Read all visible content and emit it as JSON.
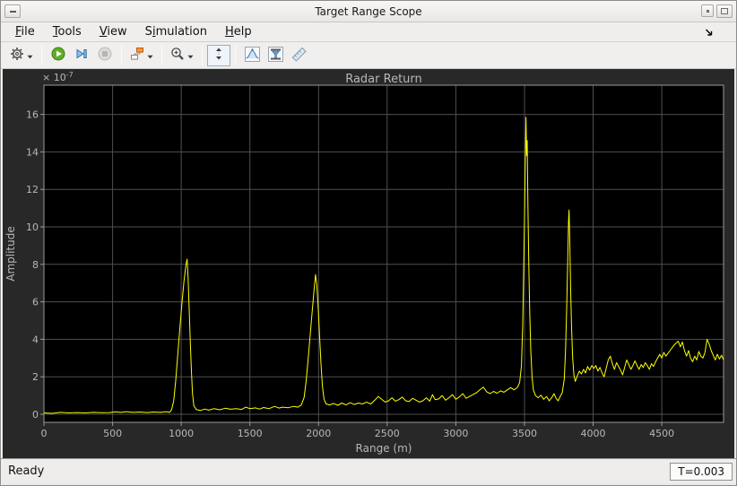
{
  "window": {
    "title": "Target Range Scope"
  },
  "titlebar": {
    "left_button": {
      "name": "minimize-button",
      "glyph": "dash"
    },
    "right_buttons": [
      {
        "name": "restore-button",
        "glyph": "dot"
      },
      {
        "name": "maximize-button",
        "glyph": "square"
      }
    ]
  },
  "menu": {
    "items": [
      {
        "label": "File",
        "mnemonic_index": 0
      },
      {
        "label": "Tools",
        "mnemonic_index": 0
      },
      {
        "label": "View",
        "mnemonic_index": 0
      },
      {
        "label": "Simulation",
        "mnemonic_index": 1
      },
      {
        "label": "Help",
        "mnemonic_index": 0
      }
    ],
    "dock_icon": "dock-arrow-icon"
  },
  "toolbar": {
    "items": [
      {
        "type": "button",
        "name": "settings",
        "icon": "gear-icon",
        "caret": true
      },
      {
        "type": "separator"
      },
      {
        "type": "button",
        "name": "run",
        "icon": "play-icon"
      },
      {
        "type": "button",
        "name": "step-forward",
        "icon": "step-forward-icon"
      },
      {
        "type": "button",
        "name": "stop",
        "icon": "stop-icon",
        "disabled": true
      },
      {
        "type": "separator"
      },
      {
        "type": "button",
        "name": "highlight-simulink-block",
        "icon": "simulink-block-icon",
        "caret": true
      },
      {
        "type": "separator"
      },
      {
        "type": "button",
        "name": "zoom",
        "icon": "zoom-in-icon",
        "caret": true
      },
      {
        "type": "separator"
      },
      {
        "type": "button",
        "name": "scale-y-axis",
        "icon": "fit-vertical-icon",
        "bordered": true
      },
      {
        "type": "separator"
      },
      {
        "type": "button",
        "name": "peak-finder",
        "icon": "peak-finder-icon"
      },
      {
        "type": "button",
        "name": "cursor-measurements",
        "icon": "cursor-measurements-icon"
      },
      {
        "type": "button",
        "name": "signal-statistics",
        "icon": "ruler-icon"
      }
    ]
  },
  "chart_data": {
    "type": "line",
    "title": "Radar Return",
    "xlabel": "Range (m)",
    "ylabel": "Amplitude",
    "y_multiplier_text": "× 10",
    "y_exponent": "-7",
    "xlim": [
      0,
      4950
    ],
    "ylim": [
      -0.43,
      17.56
    ],
    "xticks": [
      0,
      500,
      1000,
      1500,
      2000,
      2500,
      3000,
      3500,
      4000,
      4500
    ],
    "yticks": [
      0,
      2,
      4,
      6,
      8,
      10,
      12,
      14,
      16
    ],
    "grid": true,
    "legend": null,
    "colors": {
      "line": "#ffff00",
      "plot_bg": "#000000",
      "scope_bg": "#282828",
      "grid": "#4f4f4f",
      "axis": "#9a9a9a",
      "text": "#b8b8b8"
    },
    "series": [
      {
        "name": "radar-return",
        "points": [
          [
            0,
            0.07
          ],
          [
            60,
            0.05
          ],
          [
            120,
            0.1
          ],
          [
            180,
            0.07
          ],
          [
            240,
            0.09
          ],
          [
            300,
            0.07
          ],
          [
            360,
            0.1
          ],
          [
            420,
            0.08
          ],
          [
            480,
            0.09
          ],
          [
            520,
            0.13
          ],
          [
            560,
            0.1
          ],
          [
            600,
            0.14
          ],
          [
            650,
            0.1
          ],
          [
            700,
            0.12
          ],
          [
            750,
            0.09
          ],
          [
            800,
            0.12
          ],
          [
            850,
            0.1
          ],
          [
            890,
            0.14
          ],
          [
            915,
            0.1
          ],
          [
            930,
            0.25
          ],
          [
            945,
            0.7
          ],
          [
            960,
            1.8
          ],
          [
            975,
            3.2
          ],
          [
            990,
            4.6
          ],
          [
            1005,
            5.9
          ],
          [
            1020,
            7.1
          ],
          [
            1035,
            8.0
          ],
          [
            1043,
            8.28
          ],
          [
            1050,
            7.3
          ],
          [
            1058,
            5.6
          ],
          [
            1066,
            3.9
          ],
          [
            1074,
            2.3
          ],
          [
            1082,
            1.1
          ],
          [
            1092,
            0.45
          ],
          [
            1110,
            0.25
          ],
          [
            1140,
            0.2
          ],
          [
            1170,
            0.28
          ],
          [
            1200,
            0.22
          ],
          [
            1240,
            0.3
          ],
          [
            1280,
            0.24
          ],
          [
            1320,
            0.32
          ],
          [
            1360,
            0.27
          ],
          [
            1400,
            0.3
          ],
          [
            1440,
            0.26
          ],
          [
            1470,
            0.38
          ],
          [
            1500,
            0.3
          ],
          [
            1540,
            0.34
          ],
          [
            1570,
            0.28
          ],
          [
            1600,
            0.36
          ],
          [
            1640,
            0.3
          ],
          [
            1680,
            0.42
          ],
          [
            1710,
            0.33
          ],
          [
            1740,
            0.38
          ],
          [
            1780,
            0.35
          ],
          [
            1820,
            0.42
          ],
          [
            1850,
            0.38
          ],
          [
            1875,
            0.5
          ],
          [
            1895,
            0.9
          ],
          [
            1910,
            1.8
          ],
          [
            1925,
            3.0
          ],
          [
            1940,
            4.3
          ],
          [
            1955,
            5.6
          ],
          [
            1968,
            6.7
          ],
          [
            1978,
            7.45
          ],
          [
            1988,
            6.9
          ],
          [
            1998,
            5.6
          ],
          [
            2008,
            4.1
          ],
          [
            2018,
            2.7
          ],
          [
            2028,
            1.5
          ],
          [
            2040,
            0.8
          ],
          [
            2055,
            0.55
          ],
          [
            2080,
            0.5
          ],
          [
            2110,
            0.58
          ],
          [
            2140,
            0.48
          ],
          [
            2170,
            0.6
          ],
          [
            2200,
            0.5
          ],
          [
            2230,
            0.62
          ],
          [
            2260,
            0.52
          ],
          [
            2290,
            0.6
          ],
          [
            2320,
            0.55
          ],
          [
            2350,
            0.65
          ],
          [
            2380,
            0.55
          ],
          [
            2410,
            0.75
          ],
          [
            2435,
            0.95
          ],
          [
            2460,
            0.8
          ],
          [
            2485,
            0.65
          ],
          [
            2510,
            0.72
          ],
          [
            2535,
            0.88
          ],
          [
            2560,
            0.7
          ],
          [
            2585,
            0.78
          ],
          [
            2610,
            0.92
          ],
          [
            2635,
            0.72
          ],
          [
            2660,
            0.68
          ],
          [
            2685,
            0.85
          ],
          [
            2710,
            0.75
          ],
          [
            2735,
            0.65
          ],
          [
            2760,
            0.72
          ],
          [
            2785,
            0.88
          ],
          [
            2810,
            0.7
          ],
          [
            2830,
            1.05
          ],
          [
            2850,
            0.78
          ],
          [
            2875,
            0.82
          ],
          [
            2900,
            1.0
          ],
          [
            2925,
            0.75
          ],
          [
            2950,
            0.88
          ],
          [
            2975,
            1.05
          ],
          [
            3000,
            0.8
          ],
          [
            3025,
            0.92
          ],
          [
            3050,
            1.1
          ],
          [
            3075,
            0.85
          ],
          [
            3100,
            0.95
          ],
          [
            3125,
            1.05
          ],
          [
            3150,
            1.15
          ],
          [
            3175,
            1.3
          ],
          [
            3200,
            1.45
          ],
          [
            3225,
            1.2
          ],
          [
            3250,
            1.1
          ],
          [
            3275,
            1.22
          ],
          [
            3300,
            1.12
          ],
          [
            3325,
            1.25
          ],
          [
            3350,
            1.18
          ],
          [
            3375,
            1.3
          ],
          [
            3400,
            1.42
          ],
          [
            3425,
            1.3
          ],
          [
            3450,
            1.45
          ],
          [
            3465,
            1.7
          ],
          [
            3478,
            2.6
          ],
          [
            3487,
            4.8
          ],
          [
            3494,
            7.5
          ],
          [
            3500,
            10.5
          ],
          [
            3506,
            13.5
          ],
          [
            3511,
            15.85
          ],
          [
            3516,
            13.8
          ],
          [
            3520,
            14.6
          ],
          [
            3525,
            11.2
          ],
          [
            3531,
            8.2
          ],
          [
            3538,
            5.5
          ],
          [
            3546,
            3.4
          ],
          [
            3555,
            2.0
          ],
          [
            3565,
            1.3
          ],
          [
            3580,
            1.0
          ],
          [
            3600,
            0.88
          ],
          [
            3620,
            1.02
          ],
          [
            3640,
            0.8
          ],
          [
            3660,
            0.95
          ],
          [
            3680,
            0.72
          ],
          [
            3700,
            0.9
          ],
          [
            3715,
            1.1
          ],
          [
            3730,
            0.85
          ],
          [
            3745,
            0.72
          ],
          [
            3760,
            0.95
          ],
          [
            3775,
            1.15
          ],
          [
            3790,
            1.9
          ],
          [
            3800,
            3.6
          ],
          [
            3808,
            5.8
          ],
          [
            3815,
            8.2
          ],
          [
            3821,
            10.3
          ],
          [
            3825,
            10.9
          ],
          [
            3830,
            9.2
          ],
          [
            3836,
            6.8
          ],
          [
            3843,
            4.6
          ],
          [
            3851,
            3.0
          ],
          [
            3860,
            2.1
          ],
          [
            3870,
            1.75
          ],
          [
            3885,
            2.05
          ],
          [
            3900,
            2.3
          ],
          [
            3915,
            2.15
          ],
          [
            3930,
            2.4
          ],
          [
            3945,
            2.2
          ],
          [
            3960,
            2.55
          ],
          [
            3975,
            2.35
          ],
          [
            3990,
            2.6
          ],
          [
            4005,
            2.45
          ],
          [
            4020,
            2.6
          ],
          [
            4035,
            2.3
          ],
          [
            4050,
            2.5
          ],
          [
            4065,
            2.2
          ],
          [
            4080,
            2.0
          ],
          [
            4095,
            2.45
          ],
          [
            4110,
            2.9
          ],
          [
            4125,
            3.1
          ],
          [
            4140,
            2.7
          ],
          [
            4155,
            2.4
          ],
          [
            4170,
            2.75
          ],
          [
            4185,
            2.55
          ],
          [
            4200,
            2.35
          ],
          [
            4215,
            2.1
          ],
          [
            4230,
            2.5
          ],
          [
            4245,
            2.9
          ],
          [
            4260,
            2.65
          ],
          [
            4275,
            2.4
          ],
          [
            4290,
            2.6
          ],
          [
            4305,
            2.85
          ],
          [
            4320,
            2.6
          ],
          [
            4335,
            2.4
          ],
          [
            4350,
            2.65
          ],
          [
            4365,
            2.5
          ],
          [
            4380,
            2.75
          ],
          [
            4395,
            2.6
          ],
          [
            4410,
            2.4
          ],
          [
            4425,
            2.7
          ],
          [
            4440,
            2.55
          ],
          [
            4455,
            2.8
          ],
          [
            4470,
            3.0
          ],
          [
            4485,
            3.2
          ],
          [
            4500,
            3.0
          ],
          [
            4515,
            3.3
          ],
          [
            4530,
            3.1
          ],
          [
            4560,
            3.4
          ],
          [
            4590,
            3.7
          ],
          [
            4620,
            3.9
          ],
          [
            4635,
            3.6
          ],
          [
            4650,
            3.85
          ],
          [
            4665,
            3.4
          ],
          [
            4680,
            3.1
          ],
          [
            4695,
            3.4
          ],
          [
            4710,
            3.0
          ],
          [
            4725,
            2.8
          ],
          [
            4740,
            3.1
          ],
          [
            4755,
            2.9
          ],
          [
            4770,
            3.35
          ],
          [
            4785,
            3.1
          ],
          [
            4800,
            3.0
          ],
          [
            4815,
            3.3
          ],
          [
            4830,
            4.0
          ],
          [
            4845,
            3.75
          ],
          [
            4860,
            3.4
          ],
          [
            4875,
            3.15
          ],
          [
            4890,
            2.9
          ],
          [
            4905,
            3.2
          ],
          [
            4920,
            2.95
          ],
          [
            4935,
            3.15
          ],
          [
            4950,
            2.9
          ]
        ]
      }
    ]
  },
  "statusbar": {
    "left": "Ready",
    "right": "T=0.003"
  }
}
